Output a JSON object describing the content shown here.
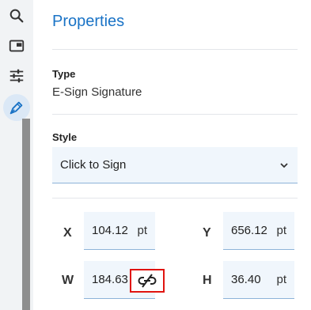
{
  "rail": {
    "icons": [
      "search-icon",
      "panel-icon",
      "sliders-icon",
      "pen-icon"
    ],
    "active": "pen-icon"
  },
  "panel": {
    "title": "Properties",
    "type_label": "Type",
    "type_value": "E-Sign Signature",
    "style_label": "Style",
    "style_value": "Click to Sign",
    "fields": {
      "x": {
        "label": "X",
        "value": "104.12",
        "unit": "pt"
      },
      "y": {
        "label": "Y",
        "value": "656.12",
        "unit": "pt"
      },
      "w": {
        "label": "W",
        "value": "184.63",
        "unit": "pt"
      },
      "h": {
        "label": "H",
        "value": "36.40",
        "unit": "pt"
      }
    },
    "aspect_lock_state": "unlinked"
  },
  "colors": {
    "accent": "#1a73c6",
    "highlight_border": "#e0140f",
    "field_bg": "#f0f6fc"
  }
}
